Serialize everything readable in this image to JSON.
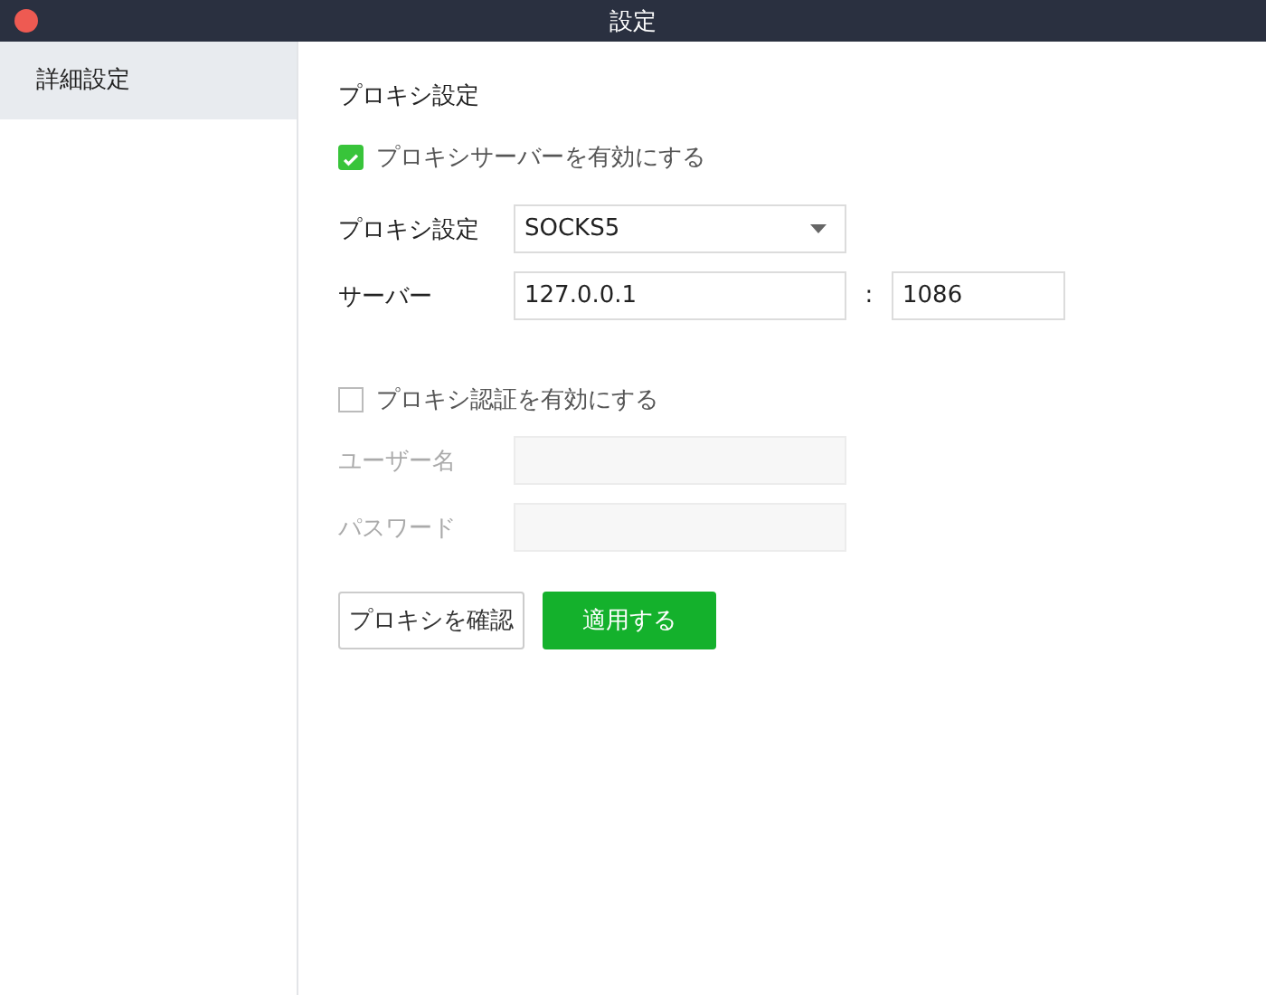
{
  "window": {
    "title": "設定"
  },
  "sidebar": {
    "items": [
      {
        "label": "詳細設定",
        "selected": true
      }
    ]
  },
  "section_title": "プロキシ設定",
  "enable_proxy": {
    "label": "プロキシサーバーを有効にする",
    "checked": true
  },
  "proxy_type": {
    "label": "プロキシ設定",
    "value": "SOCKS5"
  },
  "server": {
    "label": "サーバー",
    "host": "127.0.0.1",
    "separator": ":",
    "port": "1086"
  },
  "enable_auth": {
    "label": "プロキシ認証を有効にする",
    "checked": false
  },
  "auth_fields": [
    {
      "label": "ユーザー名",
      "disabled": true
    },
    {
      "label": "パスワード",
      "disabled": true
    }
  ],
  "buttons": [
    {
      "label": "プロキシを確認",
      "kind": "secondary"
    },
    {
      "label": "適用する",
      "kind": "primary"
    }
  ]
}
